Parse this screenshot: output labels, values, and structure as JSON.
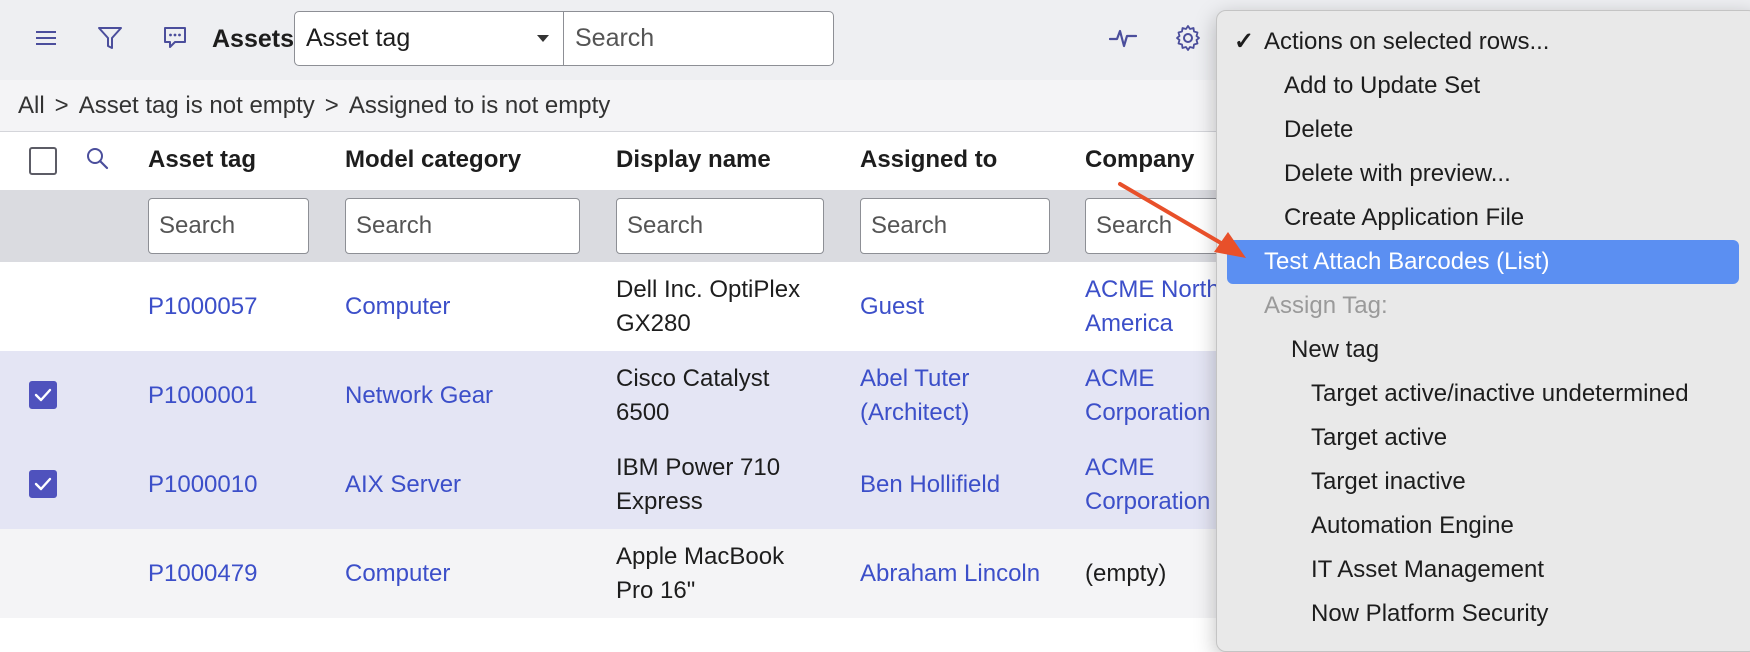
{
  "header": {
    "title": "Assets",
    "field_select": "Asset tag",
    "search_placeholder": "Search",
    "icons": [
      "hamburger-icon",
      "filter-icon",
      "chat-icon",
      "activity-icon",
      "gear-icon"
    ]
  },
  "breadcrumb": [
    "All",
    "Asset tag is not empty",
    "Assigned to is not empty"
  ],
  "breadcrumb_sep": ">",
  "columns": [
    "Asset tag",
    "Model category",
    "Display name",
    "Assigned to",
    "Company"
  ],
  "column_search_placeholder": "Search",
  "rows": [
    {
      "checked": false,
      "asset_tag": "P1000057",
      "model_category": "Computer",
      "display_name_1": "Dell Inc. OptiPlex",
      "display_name_2": "GX280",
      "assigned_1": "Guest",
      "assigned_2": "",
      "company_1": "ACME North",
      "company_2": "America"
    },
    {
      "checked": true,
      "asset_tag": "P1000001",
      "model_category": "Network Gear",
      "display_name_1": "Cisco Catalyst",
      "display_name_2": "6500",
      "assigned_1": "Abel Tuter",
      "assigned_2": "(Architect)",
      "company_1": "ACME",
      "company_2": "Corporation"
    },
    {
      "checked": true,
      "asset_tag": "P1000010",
      "model_category": "AIX Server",
      "display_name_1": "IBM Power 710",
      "display_name_2": "Express",
      "assigned_1": "Ben Hollifield",
      "assigned_2": "",
      "company_1": "ACME",
      "company_2": "Corporation"
    },
    {
      "checked": false,
      "asset_tag": "P1000479",
      "model_category": "Computer",
      "display_name_1": "Apple MacBook",
      "display_name_2": "Pro 16\"",
      "assigned_1": "Abraham Lincoln",
      "assigned_2": "",
      "company_1": "(empty)",
      "company_2": ""
    }
  ],
  "menu": {
    "checkmark": "✓",
    "items": [
      "Actions on selected rows...",
      "Add to Update Set",
      "Delete",
      "Delete with preview...",
      "Create Application File",
      "Test Attach Barcodes (List)",
      "Assign Tag:",
      "New tag",
      "Target active/inactive undetermined",
      "Target active",
      "Target inactive",
      "Automation Engine",
      "IT Asset Management",
      "Now Platform Security"
    ]
  },
  "colors": {
    "accent": "#4f52bd",
    "link": "#3c4fc9",
    "highlight": "#5b8ff2",
    "arrow": "#e8502a"
  }
}
